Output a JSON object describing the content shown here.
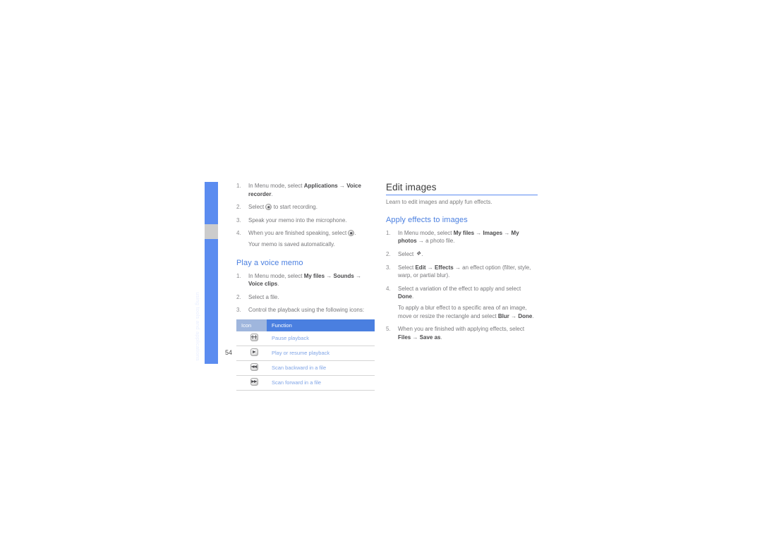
{
  "sidebar": {
    "label": "using tools and applications"
  },
  "folio": {
    "page_number": "54"
  },
  "left_column": {
    "voice_recorder_steps": [
      {
        "num": "1.",
        "prefix": "In Menu mode, select ",
        "bold1": "Applications",
        "arrow1": " → ",
        "bold2": "Voice recorder",
        "suffix": "."
      },
      {
        "num": "2.",
        "prefix": "Select ",
        "icon": "record-icon",
        "suffix": " to start recording."
      },
      {
        "num": "3.",
        "prefix": "Speak your memo into the microphone.",
        "suffix": ""
      },
      {
        "num": "4.",
        "prefix": "When you are finished speaking, select ",
        "icon": "stop-icon",
        "suffix": ".",
        "sub": "Your memo is saved automatically."
      }
    ],
    "play_memo": {
      "heading": "Play a voice memo",
      "steps": [
        {
          "num": "1.",
          "prefix": "In Menu mode, select ",
          "bold1": "My files",
          "arrow1": " → ",
          "bold2": "Sounds",
          "arrow2": " → ",
          "bold3": "Voice clips",
          "suffix": "."
        },
        {
          "num": "2.",
          "prefix": "Select a file.",
          "suffix": ""
        },
        {
          "num": "3.",
          "prefix": "Control the playback using the following icons:",
          "suffix": ""
        }
      ]
    },
    "icon_table": {
      "headers": [
        "Icon",
        "Function"
      ],
      "rows": [
        {
          "icon": "pause-icon",
          "glyph": "❙❙",
          "function": "Pause playback"
        },
        {
          "icon": "play-icon",
          "glyph": "▶",
          "function": "Play or resume playback"
        },
        {
          "icon": "rewind-icon",
          "glyph": "◀◀",
          "function": "Scan backward in a file"
        },
        {
          "icon": "forward-icon",
          "glyph": "▶▶",
          "function": "Scan forward in a file"
        }
      ]
    }
  },
  "right_column": {
    "title": "Edit images",
    "lead": "Learn to edit images and apply fun effects.",
    "subheading": "Apply effects to images",
    "steps": [
      {
        "num": "1.",
        "prefix": "In Menu mode, select ",
        "bold1": "My files",
        "arrow1": " → ",
        "bold2": "Images",
        "arrow2": " → ",
        "bold3": "My photos",
        "suffix": " → a photo file."
      },
      {
        "num": "2.",
        "prefix": "Select ",
        "icon": "options-icon",
        "suffix": "."
      },
      {
        "num": "3.",
        "prefix": "Select ",
        "bold1": "Edit",
        "arrow1": " → ",
        "bold2": "Effects",
        "suffix": " → an effect option (filter, style, warp, or partial blur)."
      },
      {
        "num": "4.",
        "prefix": "Select a variation of the effect to apply and select ",
        "bold1": "Done",
        "suffix": ".",
        "sub_prefix": "To apply a blur effect to a specific area of an image, move or resize the rectangle and select ",
        "sub_bold1": "Blur",
        "sub_arrow1": " → ",
        "sub_bold2": "Done",
        "sub_suffix": "."
      },
      {
        "num": "5.",
        "prefix": "When you are finished with applying effects, select ",
        "bold1": "Files",
        "arrow1": " → ",
        "bold2": "Save as",
        "suffix": "."
      }
    ]
  },
  "colors": {
    "accent_blue": "#4a7fe0",
    "sidebar_blue": "#5b8cf0",
    "sidebar_gray": "#cccccc",
    "table_header_icon": "#9fb6dd",
    "table_header_function": "#4a7fe0"
  }
}
